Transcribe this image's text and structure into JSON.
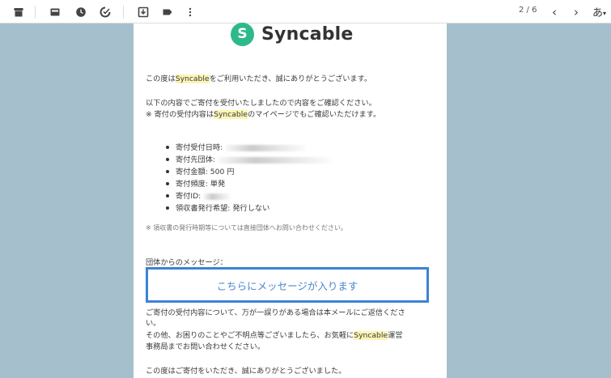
{
  "toolbar": {
    "icons": [
      "archive-icon",
      "mail-icon",
      "clock-icon",
      "check-clock-icon",
      "download-icon",
      "label-icon",
      "more-vert-icon"
    ],
    "pager": "2 / 6",
    "prev": "‹",
    "next": "›",
    "lang": "あ"
  },
  "email": {
    "logo_mark": "S",
    "logo_text": "Syncable",
    "greet_pre": "この度は",
    "greet_hl": "Syncable",
    "greet_post": "をご利用いただき、誠にありがとうございます。",
    "intro1": "以下の内容でご寄付を受付いたしましたので内容をご確認ください。",
    "intro2_pre": "※ 寄付の受付内容は",
    "intro2_hl": "Syncable",
    "intro2_post": "のマイページでもご確認いただけます。",
    "details": [
      "寄付受付日時:",
      "寄付先団体:",
      "寄付金額: 500 円",
      "寄付頻度: 単発",
      "寄付ID:",
      "領収書発行希望: 発行しない"
    ],
    "receipt_note": "※ 領収書の発行時期等については直接団体へお問い合わせください。",
    "org_msg_label": "団体からのメッセージ：",
    "org_msg_placeholder": "こちらにメッセージが入ります",
    "p1_line1": "ご寄付の受付内容について、万が一誤りがある場合は本メールにご返信くださ",
    "p1_line2": "い。",
    "p2_pre": "その他、お困りのことやご不明点等ございましたら、お気軽に",
    "p2_hl": "Syncable",
    "p2_post": "運営",
    "p2_line2": "事務局までお問い合わせください。",
    "closing": "この度はご寄付をいただき、誠にありがとうございました。"
  },
  "colors": {
    "background": "#a5bfcc",
    "brand": "#2eb98a",
    "highlight": "#fbf5b4",
    "message_border": "#3c82d5"
  }
}
